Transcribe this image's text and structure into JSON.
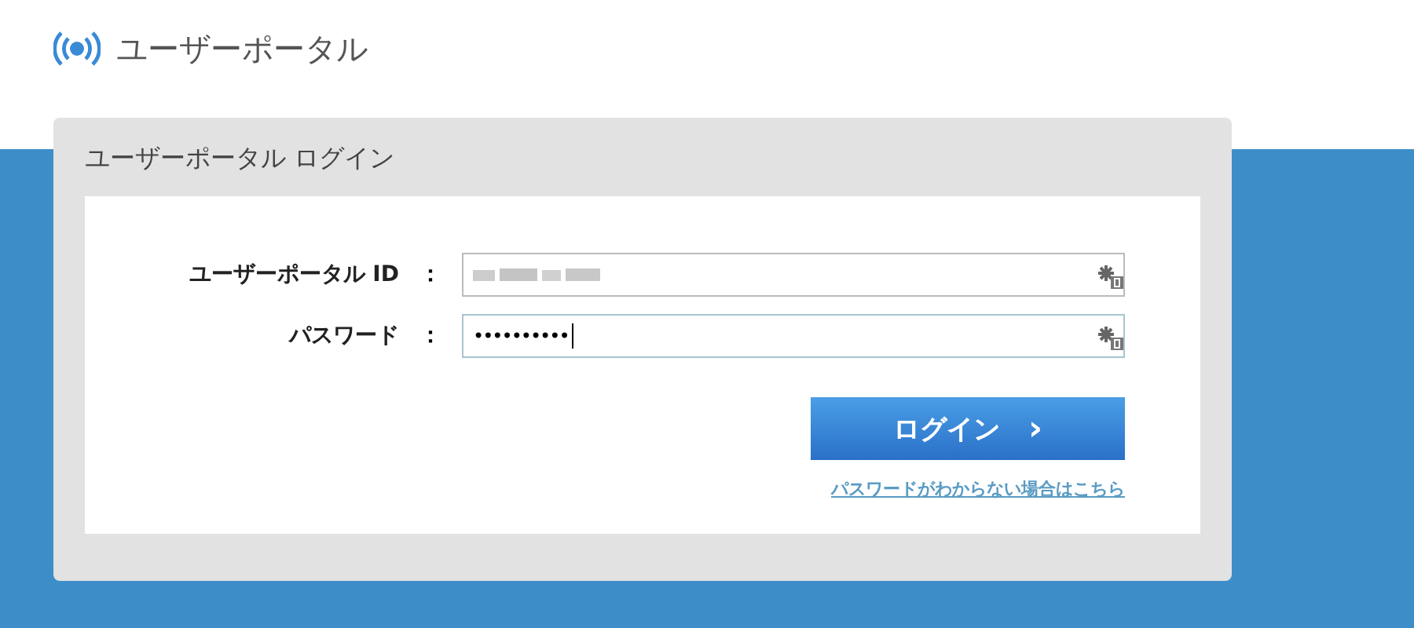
{
  "header": {
    "title": "ユーザーポータル"
  },
  "panel": {
    "title": "ユーザーポータル ログイン",
    "fields": [
      {
        "label": "ユーザーポータル ID",
        "kind": "blurred",
        "focused": false
      },
      {
        "label": "パスワード",
        "kind": "password",
        "value": "••••••••••",
        "focused": true
      }
    ],
    "separator": "：",
    "login_button": {
      "label": "ログイン",
      "icon": "›"
    },
    "forgot_link": "パスワードがわからない場合はこちら"
  }
}
